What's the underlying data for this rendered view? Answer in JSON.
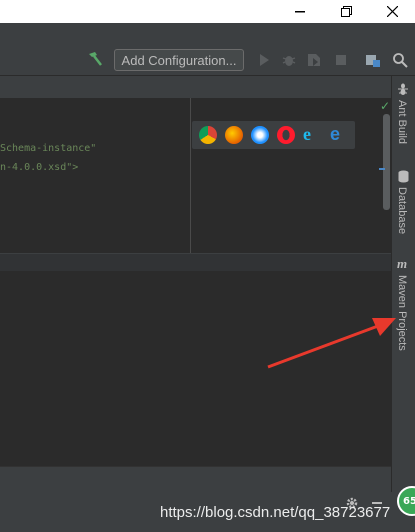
{
  "toolbar": {
    "add_configuration_label": "Add Configuration..."
  },
  "editor": {
    "code_line_1": "Schema-instance\"",
    "code_line_2": "n-4.0.0.xsd\">"
  },
  "side_panels": [
    {
      "label": "Ant Build",
      "icon": "ant-icon"
    },
    {
      "label": "Database",
      "icon": "database-icon"
    },
    {
      "label": "Maven Projects",
      "icon": "maven-icon"
    }
  ],
  "browsers": [
    "chrome-icon",
    "firefox-icon",
    "safari-icon",
    "opera-icon",
    "ie-icon",
    "edge-icon"
  ],
  "watermark": "https://blog.csdn.net/qq_38723677",
  "badge": "65",
  "colors": {
    "arrow": "#e8392c",
    "code_string": "#6a8759",
    "badge": "#3aa757"
  }
}
